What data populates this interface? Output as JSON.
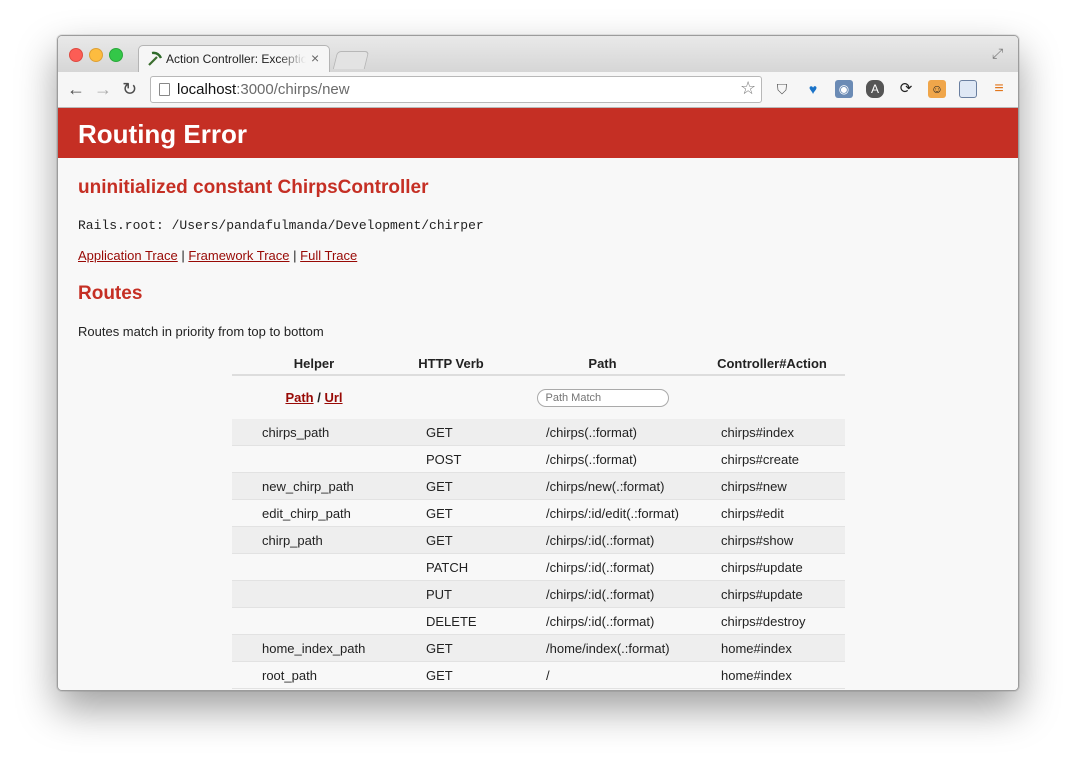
{
  "browser": {
    "tab_title": "Action Controller: Exception caught",
    "tab_close": "×",
    "url_host": "localhost",
    "url_rest": ":3000/chirps/new"
  },
  "page": {
    "banner_title": "Routing Error",
    "error_message": "uninitialized constant ChirpsController",
    "rails_root": "Rails.root: /Users/pandafulmanda/Development/chirper",
    "traces": {
      "application": "Application Trace",
      "framework": "Framework Trace",
      "full": "Full Trace",
      "separator": "|"
    },
    "routes_heading": "Routes",
    "routes_description": "Routes match in priority from top to bottom"
  },
  "routes_table": {
    "headers": {
      "helper": "Helper",
      "verb": "HTTP Verb",
      "path": "Path",
      "action": "Controller#Action"
    },
    "filter": {
      "path_link": "Path",
      "separator": "/",
      "url_link": "Url",
      "placeholder": "Path Match"
    },
    "rows": [
      {
        "helper": "chirps_path",
        "verb": "GET",
        "path": "/chirps(.:format)",
        "action": "chirps#index"
      },
      {
        "helper": "",
        "verb": "POST",
        "path": "/chirps(.:format)",
        "action": "chirps#create"
      },
      {
        "helper": "new_chirp_path",
        "verb": "GET",
        "path": "/chirps/new(.:format)",
        "action": "chirps#new"
      },
      {
        "helper": "edit_chirp_path",
        "verb": "GET",
        "path": "/chirps/:id/edit(.:format)",
        "action": "chirps#edit"
      },
      {
        "helper": "chirp_path",
        "verb": "GET",
        "path": "/chirps/:id(.:format)",
        "action": "chirps#show"
      },
      {
        "helper": "",
        "verb": "PATCH",
        "path": "/chirps/:id(.:format)",
        "action": "chirps#update"
      },
      {
        "helper": "",
        "verb": "PUT",
        "path": "/chirps/:id(.:format)",
        "action": "chirps#update"
      },
      {
        "helper": "",
        "verb": "DELETE",
        "path": "/chirps/:id(.:format)",
        "action": "chirps#destroy"
      },
      {
        "helper": "home_index_path",
        "verb": "GET",
        "path": "/home/index(.:format)",
        "action": "home#index"
      },
      {
        "helper": "root_path",
        "verb": "GET",
        "path": "/",
        "action": "home#index"
      }
    ]
  },
  "colors": {
    "banner": "#c52f24",
    "heading": "#c52f24",
    "link": "#980905"
  },
  "icons": [
    "back-icon",
    "forward-icon",
    "reload-icon",
    "page-icon",
    "star-icon",
    "pocket-icon",
    "extension-icons",
    "menu-icon"
  ]
}
